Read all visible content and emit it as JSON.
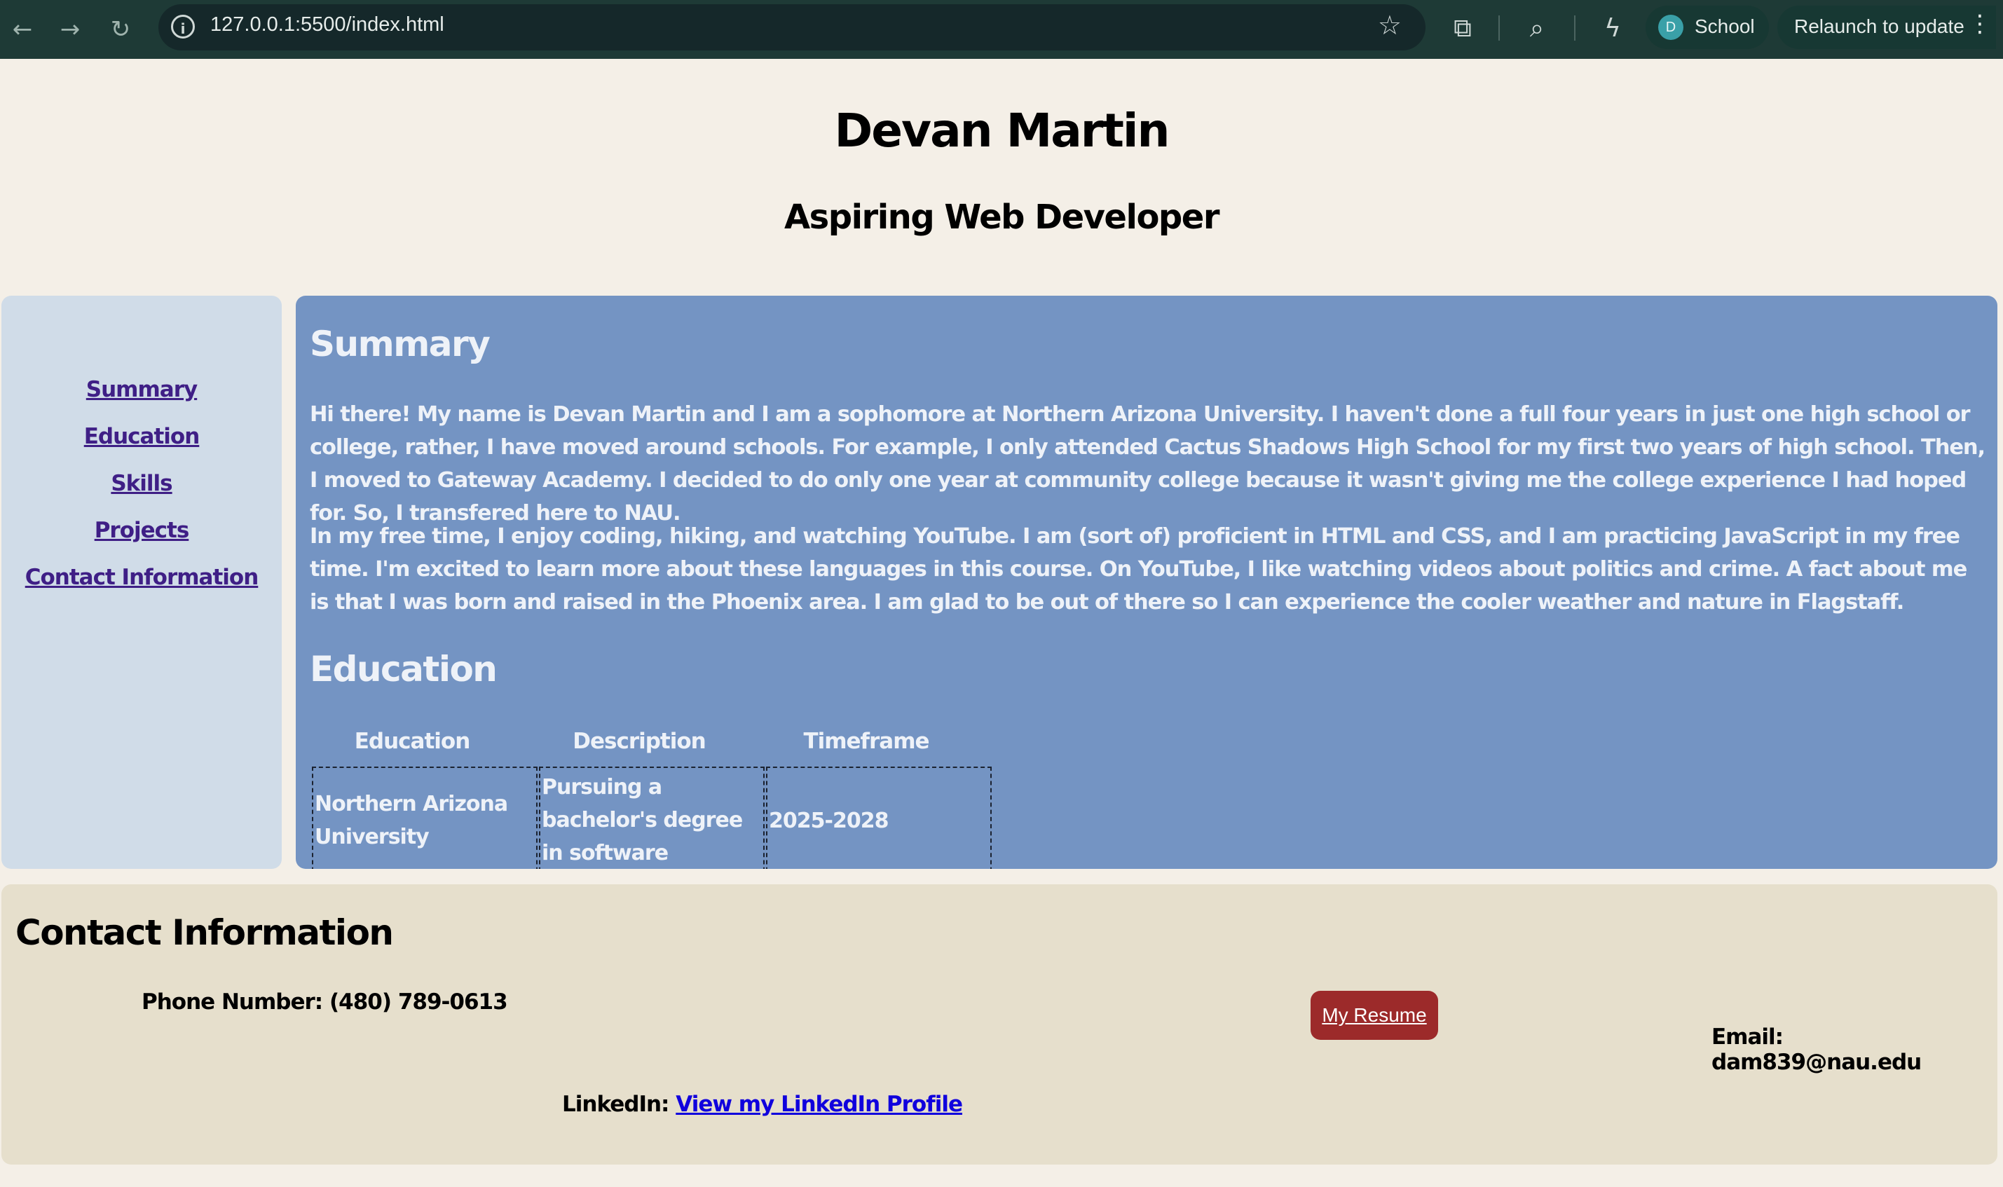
{
  "browser": {
    "url": "127.0.0.1:5500/index.html",
    "profile_initial": "D",
    "profile_name": "School",
    "relaunch_label": "Relaunch to update"
  },
  "header": {
    "name": "Devan Martin",
    "subtitle": "Aspiring Web Developer"
  },
  "sidebar": {
    "items": [
      {
        "label": "Summary"
      },
      {
        "label": "Education"
      },
      {
        "label": "Skills"
      },
      {
        "label": "Projects"
      },
      {
        "label": "Contact Information"
      }
    ]
  },
  "summary": {
    "heading": "Summary",
    "paragraphs": [
      "Hi there! My name is Devan Martin and I am a sophomore at Northern Arizona University. I haven't done a full four years in just one high school or college, rather, I have moved around schools. For example, I only attended Cactus Shadows High School for my first two years of high school. Then, I moved to Gateway Academy. I decided to do only one year at community college because it wasn't giving me the college experience I had hoped for. So, I transfered here to NAU.",
      "In my free time, I enjoy coding, hiking, and watching YouTube. I am (sort of) proficient in HTML and CSS, and I am practicing JavaScript in my free time. I'm excited to learn more about these languages in this course. On YouTube, I like watching videos about politics and crime. A fact about me is that I was born and raised in the Phoenix area. I am glad to be out of there so I can experience the cooler weather and nature in Flagstaff."
    ]
  },
  "education": {
    "heading": "Education",
    "columns": [
      "Education",
      "Description",
      "Timeframe"
    ],
    "rows": [
      [
        "Northern Arizona University",
        "Pursuing a bachelor's degree in software engineering.",
        "2025-2028"
      ]
    ]
  },
  "contact": {
    "heading": "Contact Information",
    "phone": "Phone Number: (480) 789-0613",
    "resume_label": "My Resume",
    "email": "Email: dam839@nau.edu",
    "linkedin_prefix": "LinkedIn:",
    "linkedin_link": "View my LinkedIn Profile"
  }
}
